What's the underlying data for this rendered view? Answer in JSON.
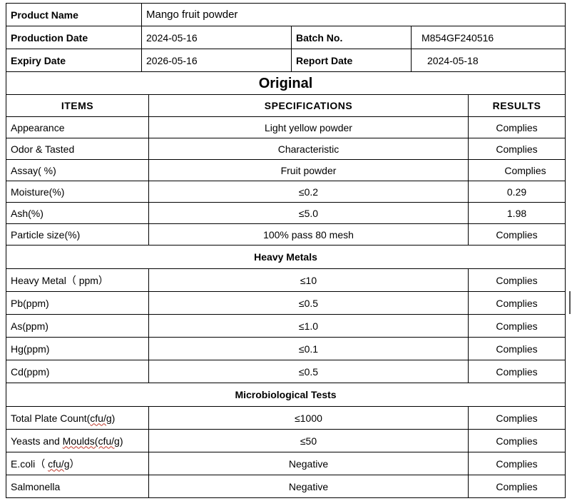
{
  "header": {
    "product_name_label": "Product Name",
    "product_name_value": "Mango fruit powder",
    "production_date_label": "Production Date",
    "production_date_value": "2024-05-16",
    "batch_no_label": "Batch No.",
    "batch_no_value": "M854GF240516",
    "expiry_date_label": "Expiry Date",
    "expiry_date_value": "2026-05-16",
    "report_date_label": "Report Date",
    "report_date_value": "2024-05-18"
  },
  "title": "Original",
  "columns": {
    "items": "ITEMS",
    "specifications": "SPECIFICATIONS",
    "results": "RESULTS"
  },
  "general": [
    {
      "item": "Appearance",
      "spec": "Light yellow powder",
      "result": "Complies"
    },
    {
      "item": "Odor & Tasted",
      "spec": "Characteristic",
      "result": "Complies"
    },
    {
      "item": "Assay( %)",
      "spec": "Fruit powder",
      "result": "Complies"
    },
    {
      "item": "Moisture(%)",
      "spec": "≤0.2",
      "result": "0.29"
    },
    {
      "item": "Ash(%)",
      "spec": "≤5.0",
      "result": "1.98"
    },
    {
      "item": "Particle size(%)",
      "spec": "100% pass 80 mesh",
      "result": "Complies"
    }
  ],
  "heavy_metals_title": "Heavy Metals",
  "heavy_metals": [
    {
      "item": "Heavy Metal（ ppm）",
      "spec": "≤10",
      "result": "Complies"
    },
    {
      "item": "Pb(ppm)",
      "spec": "≤0.5",
      "result": "Complies"
    },
    {
      "item": "As(ppm)",
      "spec": "≤1.0",
      "result": "Complies"
    },
    {
      "item": "Hg(ppm)",
      "spec": "≤0.1",
      "result": "Complies"
    },
    {
      "item": "Cd(ppm)",
      "spec": "≤0.5",
      "result": "Complies"
    }
  ],
  "micro_title": "Microbiological Tests",
  "micro": {
    "tpc_prefix": "Total Plate Count(",
    "tpc_unit": "cfu/g",
    "tpc_suffix": ")",
    "tpc_spec": "≤1000",
    "tpc_result": "Complies",
    "ym_prefix": "Yeasts and ",
    "ym_unit": "Moulds(cfu/g",
    "ym_suffix": ")",
    "ym_spec": "≤50",
    "ym_result": "Complies",
    "ecoli_prefix": "E.coli（ ",
    "ecoli_unit": "cfu/g",
    "ecoli_suffix": "）",
    "ecoli_spec": "Negative",
    "ecoli_result": "Complies",
    "salmonella_item": "Salmonella",
    "salmonella_spec": "Negative",
    "salmonella_result": "Complies"
  }
}
